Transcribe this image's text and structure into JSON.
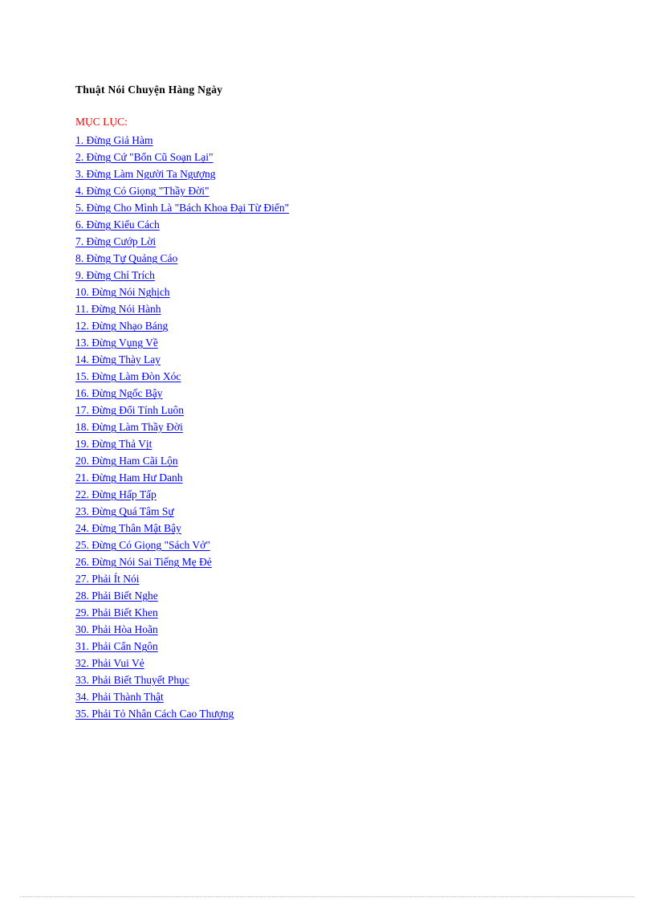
{
  "document": {
    "title": "Thuật Nói Chuyện Hàng Ngày",
    "toc_heading": "MỤC LỤC:",
    "colors": {
      "title": "#000000",
      "heading": "#ff0000",
      "link": "#0000ff",
      "background": "#ffffff",
      "footer_rule": "#aab4e0"
    },
    "toc_items": [
      "1. Đừng Giả Hàm",
      "2. Đừng Cứ \"Bổn Cũ Soạn Lại\"",
      "3. Đừng Làm Người Ta Ngượng",
      "4. Đừng Có Giọng \"Thầy Đời\"",
      "5. Đừng Cho Mình Là \"Bách Khoa Đại Từ Điển\"",
      "6. Đừng Kiểu Cách",
      "7. Đừng Cướp Lời",
      "8. Đừng Tự Quảng Cáo",
      "9. Đừng Chỉ Trích",
      "10. Đừng Nói Nghịch",
      "11. Đừng Nói Hành",
      "12. Đừng Nhạo Báng",
      "13. Đừng Vụng Về",
      "14. Đừng Thày Lay",
      "15. Đừng Làm Đòn Xóc",
      "16. Đừng Ngốc Bậy",
      "17. Đừng Đổi Tính Luôn",
      "18. Đừng Làm Thầy Đời",
      "19. Đừng Thả Vịt",
      "20. Đừng Ham Cãi Lộn",
      "21. Đừng Ham Hư Danh",
      "22. Đừng Hấp Tấp",
      "23. Đừng Quá Tâm Sự",
      "24. Đừng Thân Mật Bậy",
      "25. Đừng Có Giọng \"Sách Vở\"",
      "26. Đừng Nói Sai Tiếng Mẹ Đẻ",
      "27. Phải Ít Nói",
      "28. Phải Biết Nghe",
      "29. Phải Biết Khen",
      "30. Phải Hòa Hoãn",
      "31. Phải Cẩn Ngôn",
      "32. Phải Vui Vẻ",
      "33. Phải Biết Thuyết Phục",
      "34. Phải Thành Thật",
      "35. Phải Tỏ Nhân Cách Cao Thượng"
    ]
  }
}
